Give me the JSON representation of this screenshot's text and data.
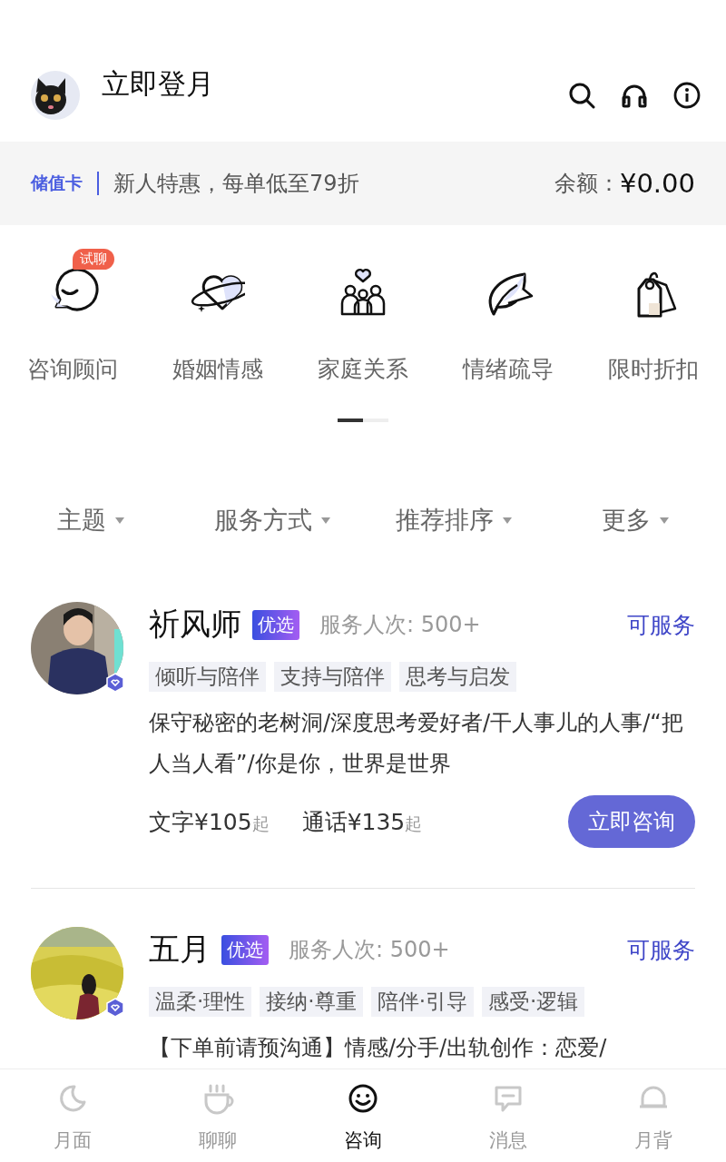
{
  "header": {
    "title": "立即登月"
  },
  "promo": {
    "label": "储值卡",
    "text": "新人特惠，每单低至79折",
    "balance_label": "余额：",
    "balance": "¥0.00"
  },
  "categories": [
    {
      "label": "咨询顾问",
      "badge": "试聊"
    },
    {
      "label": "婚姻情感"
    },
    {
      "label": "家庭关系"
    },
    {
      "label": "情绪疏导"
    },
    {
      "label": "限时折扣"
    }
  ],
  "filters": [
    "主题",
    "服务方式",
    "推荐排序",
    "更多"
  ],
  "counselors": [
    {
      "name": "祈风师",
      "badge": "优选",
      "served": "服务人次: 500+",
      "status": "可服务",
      "tags": [
        "倾听与陪伴",
        "支持与陪伴",
        "思考与启发"
      ],
      "bio": "保守秘密的老树洞/深度思考爱好者/干人事儿的人事/“把人当人看”/你是你，世界是世界",
      "prices": [
        {
          "text": "文字¥105",
          "suffix": "起"
        },
        {
          "text": "通话¥135",
          "suffix": "起"
        }
      ],
      "button": "立即咨询"
    },
    {
      "name": "五月",
      "badge": "优选",
      "served": "服务人次: 500+",
      "status": "可服务",
      "tags": [
        "温柔·理性",
        "接纳·尊重",
        "陪伴·引导",
        "感受·逻辑"
      ],
      "bio": "【下单前请预沟通】情感/分手/出轨创作：恋爱/"
    }
  ],
  "tabs": [
    {
      "label": "月面",
      "selected": false
    },
    {
      "label": "聊聊",
      "selected": false
    },
    {
      "label": "咨询",
      "selected": true
    },
    {
      "label": "消息",
      "selected": false
    },
    {
      "label": "月背",
      "selected": false
    }
  ]
}
